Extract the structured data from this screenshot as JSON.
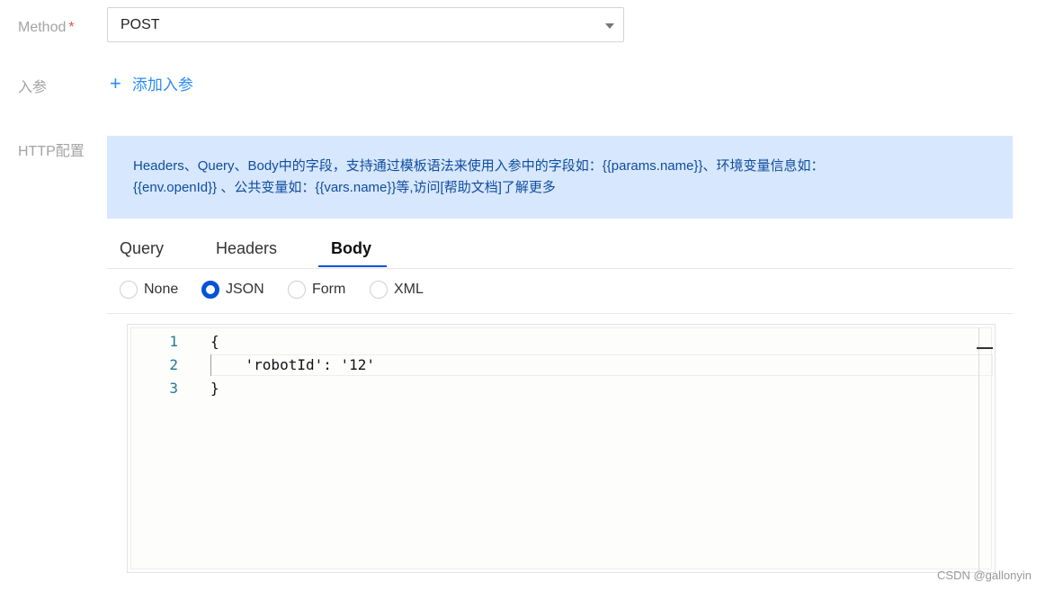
{
  "form": {
    "method_label": "Method",
    "required_mark": "*",
    "method_value": "POST",
    "params_label": "入参",
    "add_params": "添加入参",
    "add_icon": "+",
    "http_label": "HTTP配置"
  },
  "info": {
    "line1": "Headers、Query、Body中的字段，支持通过模板语法来使用入参中的字段如：{{params.name}}、环境变量信息如：",
    "line2": "{{env.openId}} 、公共变量如：{{vars.name}}等,访问[帮助文档]了解更多"
  },
  "tabs": [
    "Query",
    "Headers",
    "Body"
  ],
  "active_tab": "Body",
  "body_types": [
    "None",
    "JSON",
    "Form",
    "XML"
  ],
  "selected_body_type": "JSON",
  "editor": {
    "line_numbers": [
      "1",
      "2",
      "3"
    ],
    "lines": [
      "{",
      "    'robotId': '12'",
      "}"
    ]
  },
  "watermark": "CSDN @gallonyin",
  "colors": {
    "accent": "#0052d9",
    "link": "#2d8cf0",
    "info_bg": "#d7e7fd",
    "info_text": "#0f4d9e"
  }
}
